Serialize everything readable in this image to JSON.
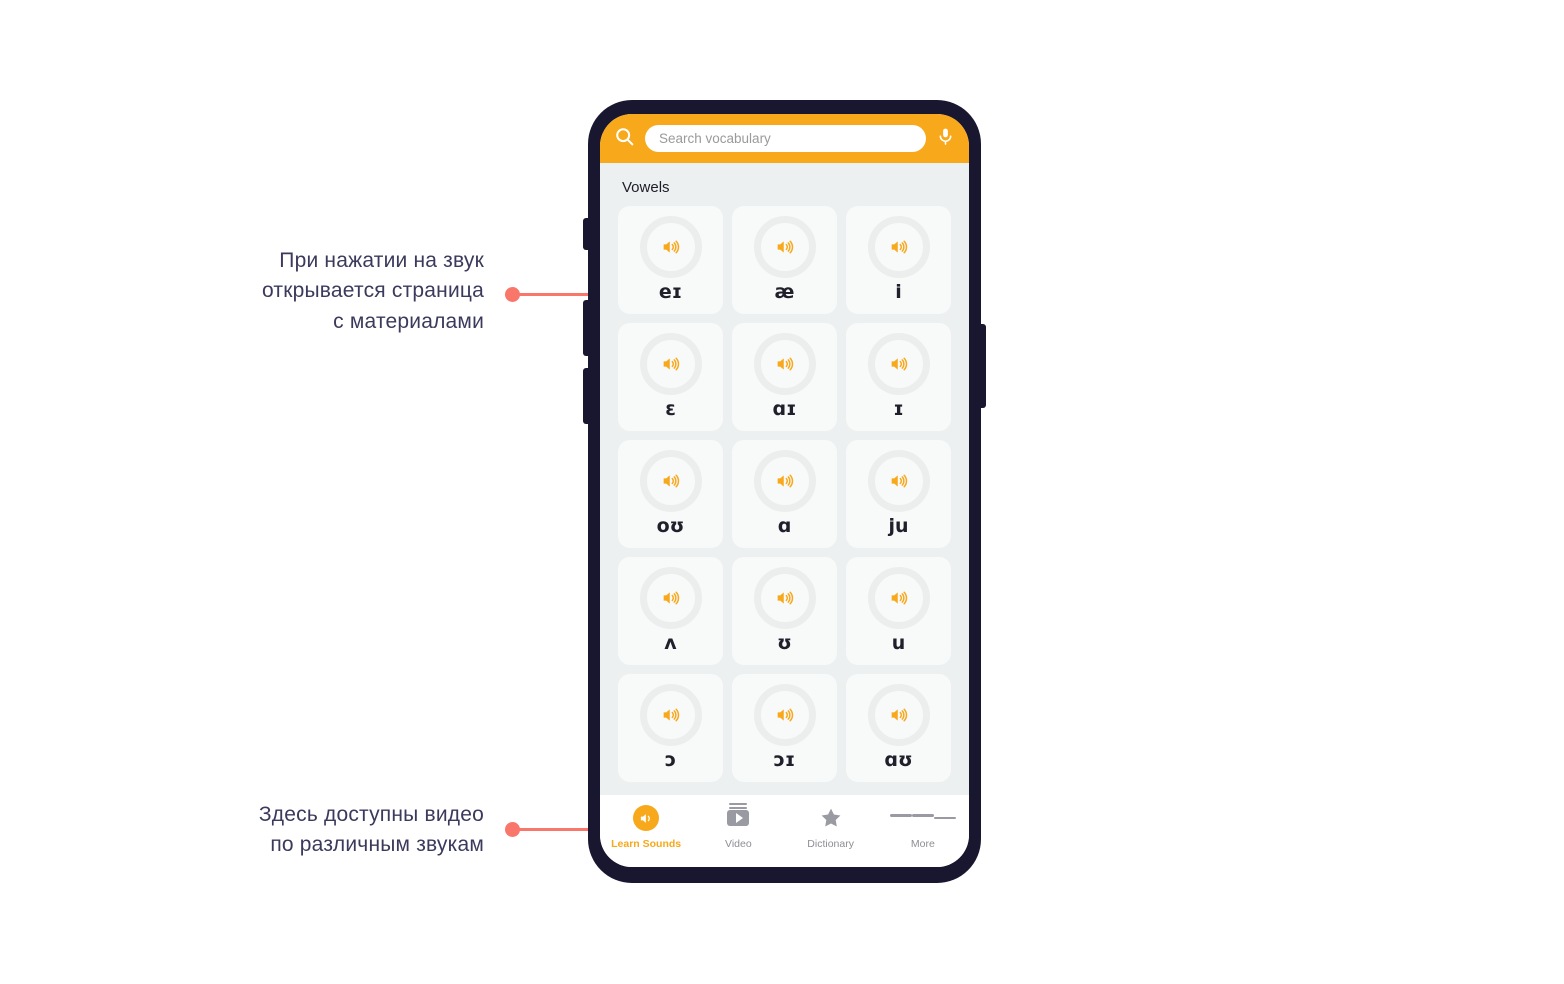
{
  "annotations": [
    {
      "id": "top",
      "text": "При нажатии на звук\nоткрывается страница\nс материалами",
      "accent_color": "#f9766a"
    },
    {
      "id": "bottom",
      "text": "Здесь доступны видео\nпо различным звукам",
      "accent_color": "#f9766a"
    }
  ],
  "phone": {
    "frame_color": "#191730",
    "screen_background": "#edf0f1"
  },
  "search": {
    "placeholder": "Search vocabulary",
    "value": "",
    "bar_color": "#f7a81b",
    "search_icon": "search-icon",
    "mic_icon": "microphone-icon"
  },
  "section": {
    "heading": "Vowels"
  },
  "sounds": [
    {
      "symbol": "eɪ",
      "icon": "speaker-icon"
    },
    {
      "symbol": "æ",
      "icon": "speaker-icon"
    },
    {
      "symbol": "i",
      "icon": "speaker-icon"
    },
    {
      "symbol": "ɛ",
      "icon": "speaker-icon"
    },
    {
      "symbol": "ɑɪ",
      "icon": "speaker-icon"
    },
    {
      "symbol": "ɪ",
      "icon": "speaker-icon"
    },
    {
      "symbol": "oʊ",
      "icon": "speaker-icon"
    },
    {
      "symbol": "ɑ",
      "icon": "speaker-icon"
    },
    {
      "symbol": "ju",
      "icon": "speaker-icon"
    },
    {
      "symbol": "ʌ",
      "icon": "speaker-icon"
    },
    {
      "symbol": "ʊ",
      "icon": "speaker-icon"
    },
    {
      "symbol": "u",
      "icon": "speaker-icon"
    },
    {
      "symbol": "ɔ",
      "icon": "speaker-icon"
    },
    {
      "symbol": "ɔɪ",
      "icon": "speaker-icon"
    },
    {
      "symbol": "ɑʊ",
      "icon": "speaker-icon"
    }
  ],
  "bottom_nav": {
    "active_color": "#f7a81b",
    "inactive_color": "#8d8d95",
    "items": [
      {
        "label": "Learn Sounds",
        "icon": "learn-sounds-icon",
        "active": true
      },
      {
        "label": "Video",
        "icon": "video-icon",
        "active": false
      },
      {
        "label": "Dictionary",
        "icon": "star-icon",
        "active": false
      },
      {
        "label": "More",
        "icon": "hamburger-icon",
        "active": false
      }
    ]
  }
}
